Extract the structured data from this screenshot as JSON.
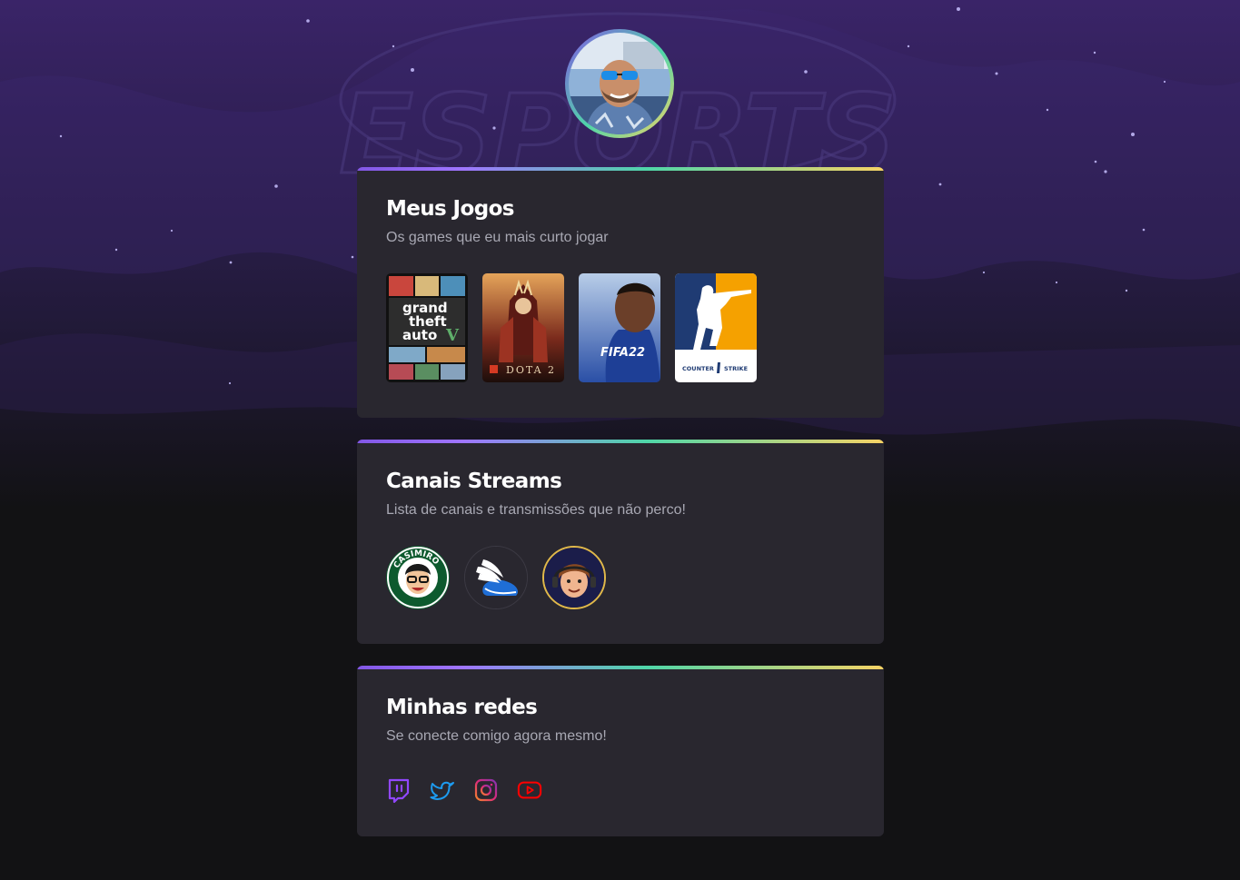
{
  "profile": {
    "avatar_alt": "profile photo"
  },
  "background": {
    "watermark_text": "ESPORTS"
  },
  "sections": {
    "games": {
      "title": "Meus Jogos",
      "subtitle": "Os games que eu mais curto jogar",
      "items": [
        {
          "name": "Grand Theft Auto V",
          "cover_lines": [
            "grand",
            "theft",
            "auto"
          ],
          "badge": "V"
        },
        {
          "name": "Dota 2",
          "cover_text": "DOTA 2"
        },
        {
          "name": "FIFA 22",
          "cover_text": "FIFA22"
        },
        {
          "name": "Counter-Strike",
          "cover_text_left": "COUNTER",
          "cover_text_right": "STRIKE"
        }
      ]
    },
    "streams": {
      "title": "Canais Streams",
      "subtitle": "Lista de canais e transmissões que não perco!",
      "items": [
        {
          "name": "Casimiro",
          "ring_text": "CASIMIRO"
        },
        {
          "name": "Winged shoe channel"
        },
        {
          "name": "Cartoon streamer"
        }
      ]
    },
    "socials": {
      "title": "Minhas redes",
      "subtitle": "Se conecte comigo agora mesmo!",
      "items": [
        {
          "name": "twitch",
          "icon": "twitch-icon",
          "color": "#9147ff"
        },
        {
          "name": "twitter",
          "icon": "twitter-icon",
          "color": "#1d9bf0"
        },
        {
          "name": "instagram",
          "icon": "instagram-icon",
          "color": "#e1306c"
        },
        {
          "name": "youtube",
          "icon": "youtube-icon",
          "color": "#ff0000"
        }
      ]
    }
  },
  "colors": {
    "page_background": "#121214",
    "card_background": "#29272f",
    "accent_gradient": [
      "#8257e5",
      "#4fd6a8",
      "#f6d365"
    ]
  }
}
